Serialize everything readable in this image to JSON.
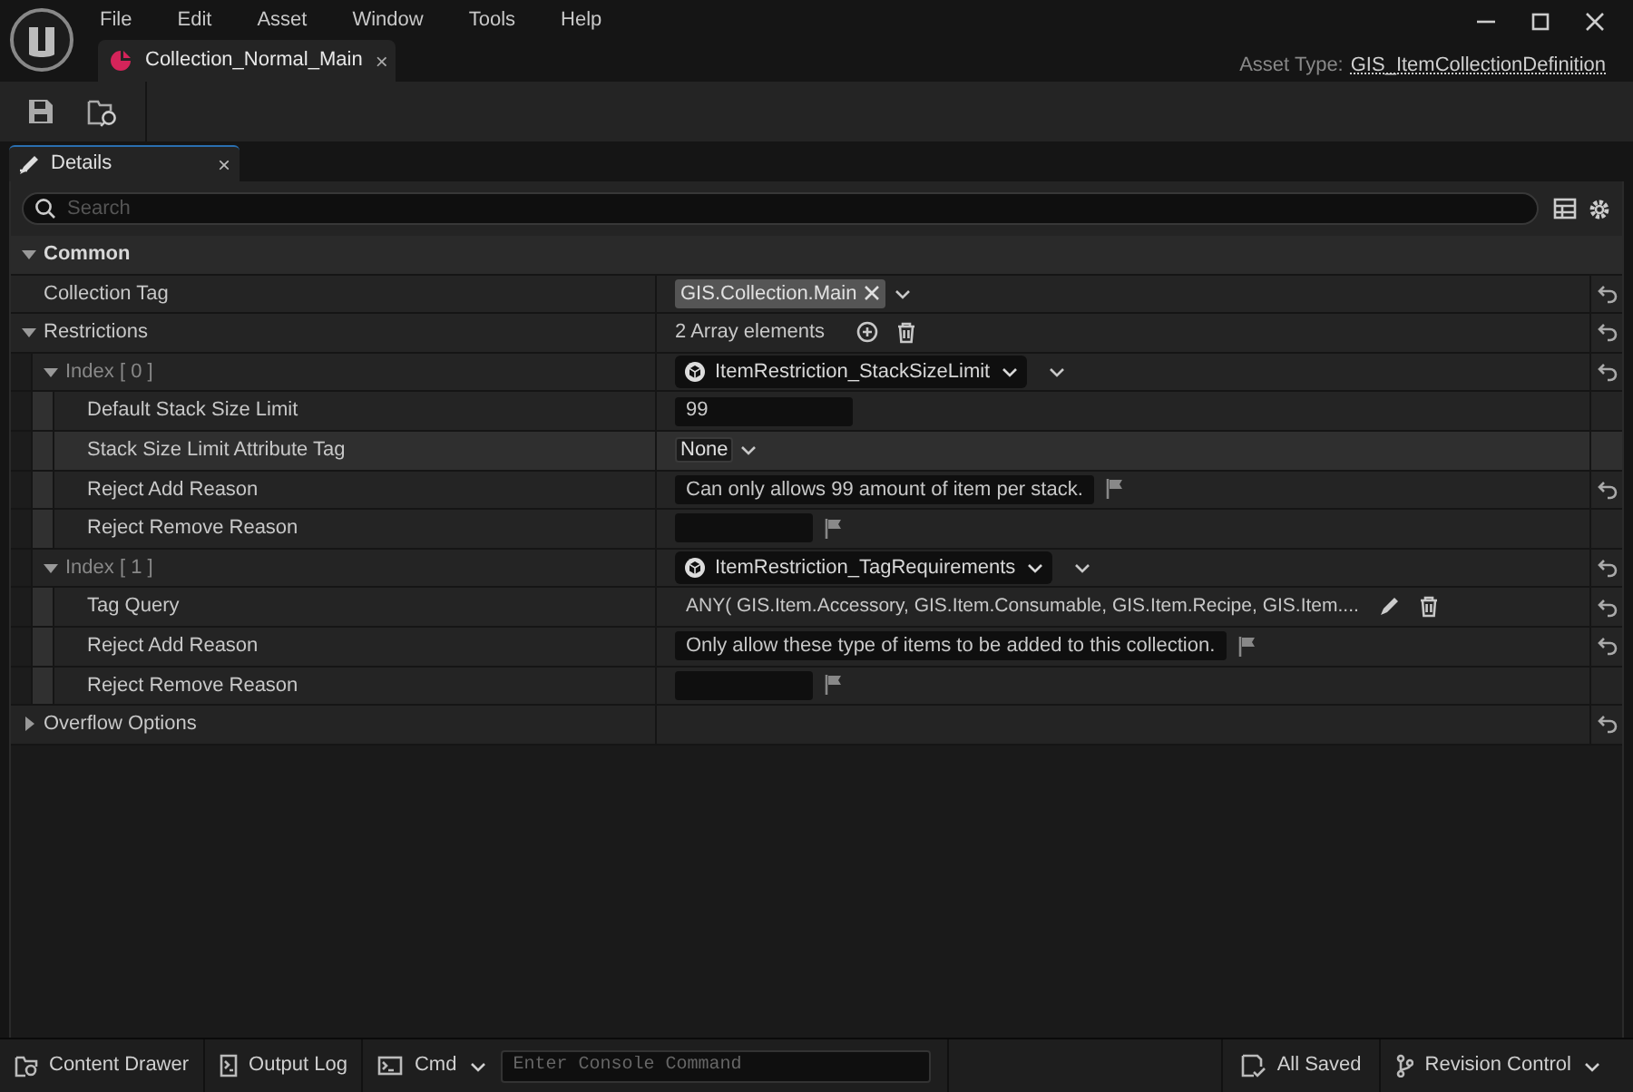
{
  "window": {
    "menu": [
      "File",
      "Edit",
      "Asset",
      "Window",
      "Tools",
      "Help"
    ],
    "tab": {
      "title": "Collection_Normal_Main",
      "close": "×",
      "selected": true
    },
    "asset_type_label": "Asset Type:",
    "asset_type": "GIS_ItemCollectionDefinition"
  },
  "details": {
    "tab": {
      "title": "Details",
      "close": "×",
      "selected": true
    },
    "search": {
      "placeholder": "Search"
    },
    "properties": [
      {
        "kind": "category",
        "label": "Common",
        "expanded": true,
        "children": [
          {
            "kind": "tag",
            "label": "Collection Tag",
            "value": "GIS.Collection.Main",
            "resettable": true,
            "hovered": false
          },
          {
            "kind": "array",
            "label": "Restrictions",
            "value": "2 Array elements",
            "expanded": true,
            "resettable": true,
            "hovered": false,
            "children": [
              {
                "kind": "class_picker",
                "label": "Index [ 0 ]",
                "value": "ItemRestriction_StackSizeLimit",
                "expanded": true,
                "resettable": true,
                "hovered": false,
                "children": [
                  {
                    "kind": "number",
                    "label": "Default Stack Size Limit",
                    "value": "99",
                    "resettable": false,
                    "hovered": false
                  },
                  {
                    "kind": "tag_none",
                    "label": "Stack Size Limit Attribute Tag",
                    "value": "None",
                    "resettable": false,
                    "hovered": true
                  },
                  {
                    "kind": "text",
                    "label": "Reject Add Reason",
                    "value": "Can only allows 99 amount of item per stack.",
                    "resettable": true,
                    "hovered": false
                  },
                  {
                    "kind": "text",
                    "label": "Reject Remove Reason",
                    "resettable": false,
                    "hovered": false
                  }
                ]
              },
              {
                "kind": "class_picker",
                "label": "Index [ 1 ]",
                "value": "ItemRestriction_TagRequirements",
                "expanded": true,
                "resettable": true,
                "hovered": false,
                "children": [
                  {
                    "kind": "query",
                    "label": "Tag Query",
                    "value": "ANY( GIS.Item.Accessory, GIS.Item.Consumable, GIS.Item.Recipe, GIS.Item....",
                    "resettable": true,
                    "hovered": false
                  },
                  {
                    "kind": "text",
                    "label": "Reject Add Reason",
                    "value": "Only allow these type of items to be added to this collection.",
                    "resettable": true,
                    "hovered": false
                  },
                  {
                    "kind": "text",
                    "label": "Reject Remove Reason",
                    "resettable": false,
                    "hovered": false
                  }
                ]
              }
            ]
          },
          {
            "kind": "struct",
            "label": "Overflow Options",
            "expanded": false,
            "resettable": true,
            "hovered": false
          }
        ]
      }
    ]
  },
  "status_bar": {
    "content_drawer": "Content Drawer",
    "output_log": "Output Log",
    "cmd": "Cmd",
    "console": {
      "placeholder": "Enter Console Command"
    },
    "saved": "All Saved",
    "revision_control": "Revision Control"
  }
}
